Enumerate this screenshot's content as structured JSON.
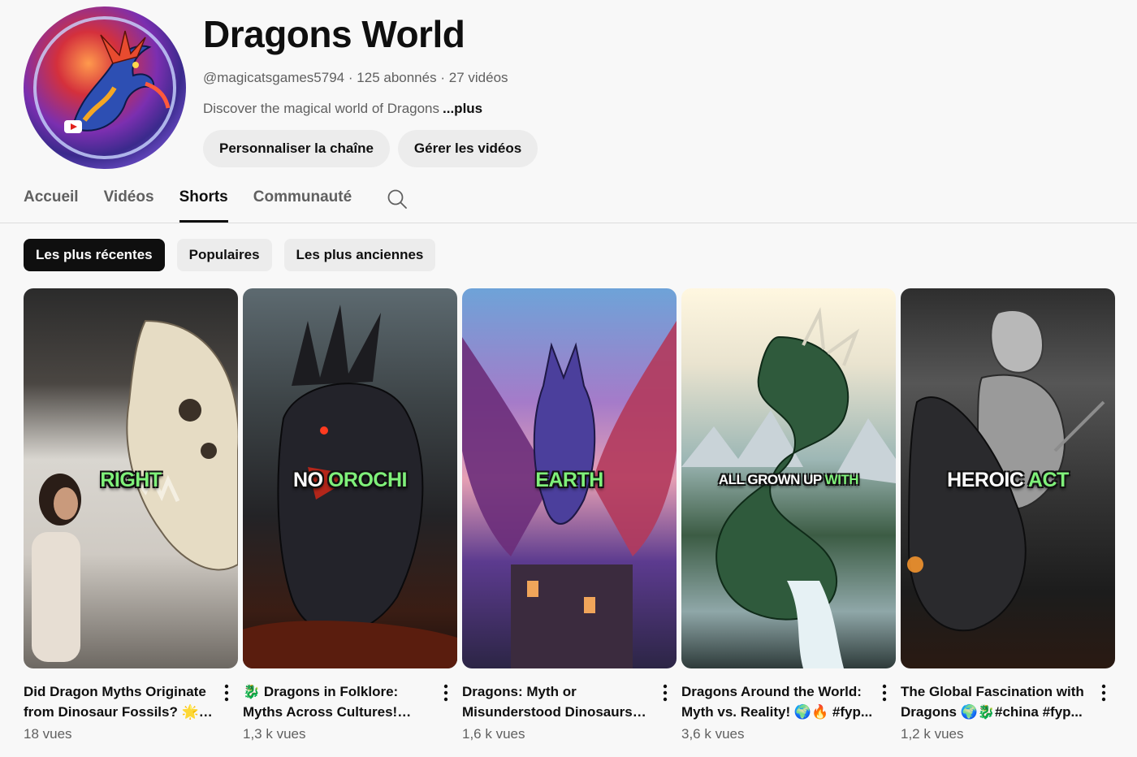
{
  "channel": {
    "name": "Dragons World",
    "handle": "@magicatsgames5794",
    "subscribers": "125 abonnés",
    "videos_count": "27 vidéos",
    "separator": "·",
    "description": "Discover the magical world of Dragons",
    "more_label": "...plus"
  },
  "actions": {
    "customize_label": "Personnaliser la chaîne",
    "manage_label": "Gérer les vidéos"
  },
  "tabs": [
    {
      "label": "Accueil",
      "active": false
    },
    {
      "label": "Vidéos",
      "active": false
    },
    {
      "label": "Shorts",
      "active": true
    },
    {
      "label": "Communauté",
      "active": false
    }
  ],
  "chips": [
    {
      "label": "Les plus récentes",
      "active": true
    },
    {
      "label": "Populaires",
      "active": false
    },
    {
      "label": "Les plus anciennes",
      "active": false
    }
  ],
  "shorts": [
    {
      "caption_white": "",
      "caption_green": "RIGHT",
      "title": "Did Dragon Myths Originate from Dinosaur Fossils? 🌟🦕",
      "views": "18 vues"
    },
    {
      "caption_white": "NO ",
      "caption_green": "OROCHI",
      "title": "🐉 Dragons in Folklore: Myths Across Cultures! #Dragons...",
      "views": "1,3 k vues"
    },
    {
      "caption_white": "",
      "caption_green": "EARTH",
      "title": "Dragons: Myth or Misunderstood Dinosaurs? ...",
      "views": "1,6 k vues"
    },
    {
      "caption_white": "ALL GROWN UP ",
      "caption_green": "WITH",
      "title": "Dragons Around the World: Myth vs. Reality! 🌍🔥 #fyp...",
      "views": "3,6 k vues"
    },
    {
      "caption_white": "HEROIC ",
      "caption_green": "ACT",
      "title": "The Global Fascination with Dragons 🌍🐉#china #fyp...",
      "views": "1,2 k vues"
    }
  ],
  "colors": {
    "background": "#f8f8f8",
    "text_primary": "#0f0f0f",
    "text_secondary": "#606060",
    "chip_bg": "#ececec",
    "caption_green": "#7ff07a"
  }
}
